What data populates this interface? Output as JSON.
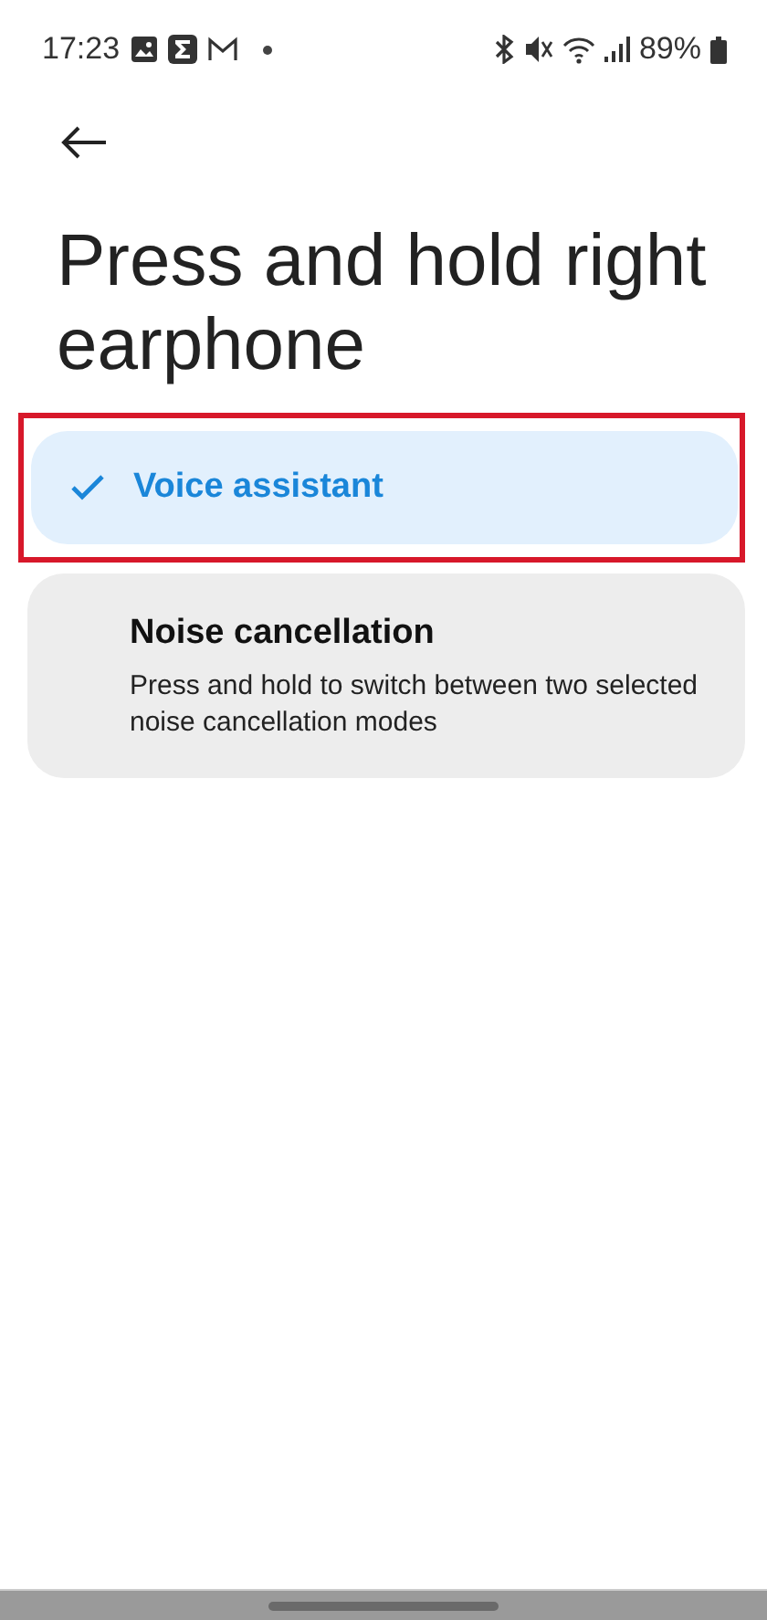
{
  "status_bar": {
    "time": "17:23",
    "battery": "89%"
  },
  "title": "Press and hold right earphone",
  "options": [
    {
      "label": "Voice assistant",
      "selected": true,
      "highlighted": true
    },
    {
      "label": "Noise cancellation",
      "description": "Press and hold to switch between two selected noise cancellation modes",
      "selected": false,
      "highlighted": false
    }
  ]
}
